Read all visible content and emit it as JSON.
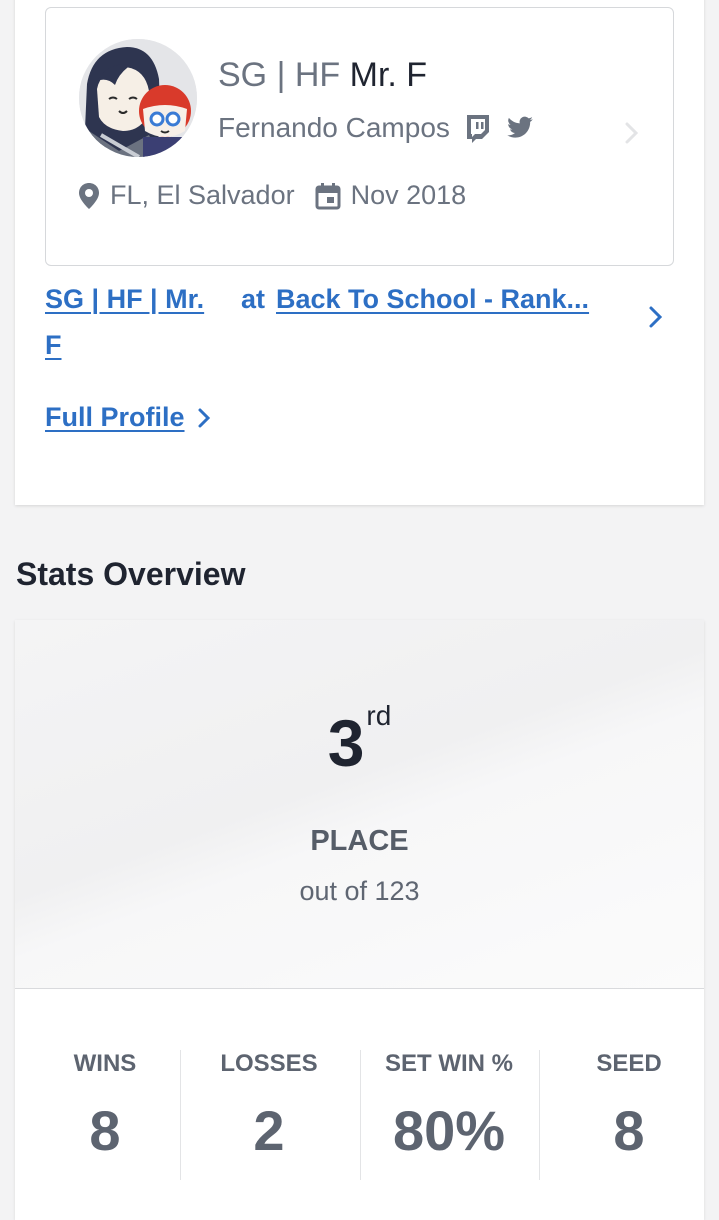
{
  "profile": {
    "prefix": "SG | HF",
    "gamertag": "Mr. F",
    "real_name": "Fernando Campos",
    "location": "FL, El Salvador",
    "joined": "Nov 2018",
    "icons": [
      "twitch-icon",
      "twitter-icon",
      "location-pin-icon",
      "calendar-icon"
    ]
  },
  "entrant_link": {
    "player": "SG | HF | Mr. F",
    "at": "at",
    "event": "Back To School - Rank..."
  },
  "full_profile": {
    "label": "Full Profile"
  },
  "stats": {
    "section_title": "Stats Overview",
    "place_number": "3",
    "place_suffix": "rd",
    "place_label": "PLACE",
    "out_of": "out of 123",
    "items": [
      {
        "label": "WINS",
        "value": "8"
      },
      {
        "label": "LOSSES",
        "value": "2"
      },
      {
        "label": "SET WIN %",
        "value": "80%"
      },
      {
        "label": "SEED",
        "value": "8"
      }
    ]
  },
  "colors": {
    "link": "#2d6fc4",
    "text_dark": "#1f2430",
    "text_muted": "#6b7380",
    "background": "#f3f3f4"
  }
}
